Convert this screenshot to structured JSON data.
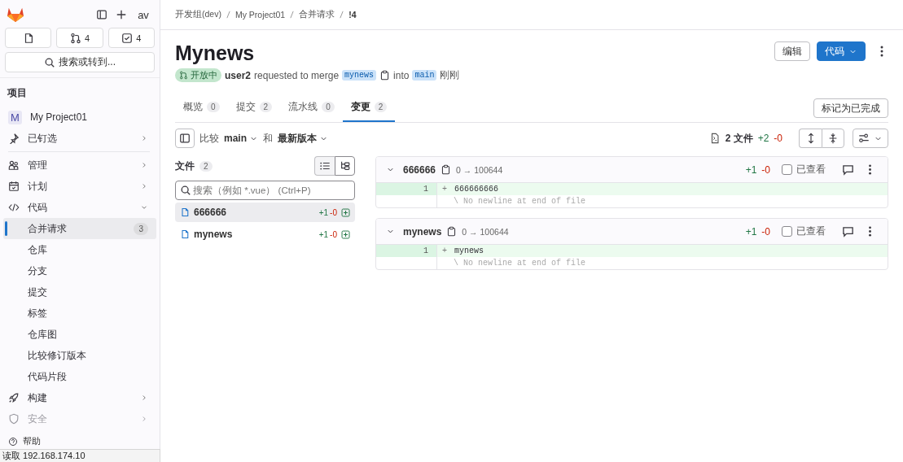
{
  "sidebar": {
    "avatar": "av",
    "counters": [
      {
        "kind": "doc"
      },
      {
        "kind": "merge",
        "count": "4"
      },
      {
        "kind": "todo",
        "count": "4"
      }
    ],
    "search_button": "搜索或转到...",
    "section_title": "项目",
    "project": {
      "initial": "M",
      "name": "My Project01"
    },
    "items": [
      {
        "label": "已钉选",
        "expanded": false,
        "disabled": false
      },
      {
        "label": "管理",
        "expanded": false,
        "disabled": false
      },
      {
        "label": "计划",
        "expanded": false,
        "disabled": false
      },
      {
        "label": "代码",
        "expanded": true,
        "disabled": false,
        "children": [
          {
            "label": "合并请求",
            "selected": true,
            "count": "3"
          },
          {
            "label": "仓库",
            "selected": false
          },
          {
            "label": "分支",
            "selected": false
          },
          {
            "label": "提交",
            "selected": false
          },
          {
            "label": "标签",
            "selected": false
          },
          {
            "label": "仓库图",
            "selected": false
          },
          {
            "label": "比较修订版本",
            "selected": false
          },
          {
            "label": "代码片段",
            "selected": false
          }
        ]
      },
      {
        "label": "构建",
        "expanded": false,
        "disabled": false
      },
      {
        "label": "安全",
        "expanded": false,
        "disabled": true
      }
    ],
    "help": "帮助"
  },
  "status_bar": "读取 192.168.174.10",
  "breadcrumbs": [
    "开发组(dev)",
    "My Project01",
    "合并请求",
    "!4"
  ],
  "title": "Mynews",
  "status_badge": "开放中",
  "meta": {
    "author": "user2",
    "text": "requested to merge",
    "source": "mynews",
    "into": "into",
    "target": "main",
    "time": "刚刚"
  },
  "header_buttons": {
    "edit": "编辑",
    "code": "代码"
  },
  "tabs": [
    {
      "label": "概览",
      "count": "0",
      "selected": false
    },
    {
      "label": "提交",
      "count": "2",
      "selected": false
    },
    {
      "label": "流水线",
      "count": "0",
      "selected": false
    },
    {
      "label": "变更",
      "count": "2",
      "selected": true
    }
  ],
  "mark_done": "标记为已完成",
  "compare": {
    "label": "比较",
    "base": "main",
    "and": "和",
    "head": "最新版本"
  },
  "summary": {
    "files": "2 文件",
    "added": "+2",
    "removed": "-0"
  },
  "file_tree": {
    "title": "文件",
    "count": "2",
    "placeholder": "搜索（例如 *.vue） (Ctrl+P)",
    "view_modes": [
      {
        "kind": "list",
        "selected": false
      },
      {
        "kind": "tree",
        "selected": true
      }
    ],
    "files": [
      {
        "name": "666666",
        "added": "+1",
        "removed": "-0",
        "selected": true
      },
      {
        "name": "mynews",
        "added": "+1",
        "removed": "-0",
        "selected": false
      }
    ]
  },
  "diffs": [
    {
      "name": "666666",
      "mode": "0 → 100644",
      "added": "+1",
      "removed": "-0",
      "viewed_label": "已查看",
      "viewed": false,
      "expanded": true,
      "lines": [
        {
          "number": "1",
          "sign": "+",
          "text": "666666666"
        }
      ],
      "note": "\\ No newline at end of file"
    },
    {
      "name": "mynews",
      "mode": "0 → 100644",
      "added": "+1",
      "removed": "-0",
      "viewed_label": "已查看",
      "viewed": false,
      "expanded": true,
      "lines": [
        {
          "number": "1",
          "sign": "+",
          "text": "mynews"
        }
      ],
      "note": "\\ No newline at end of file"
    }
  ]
}
